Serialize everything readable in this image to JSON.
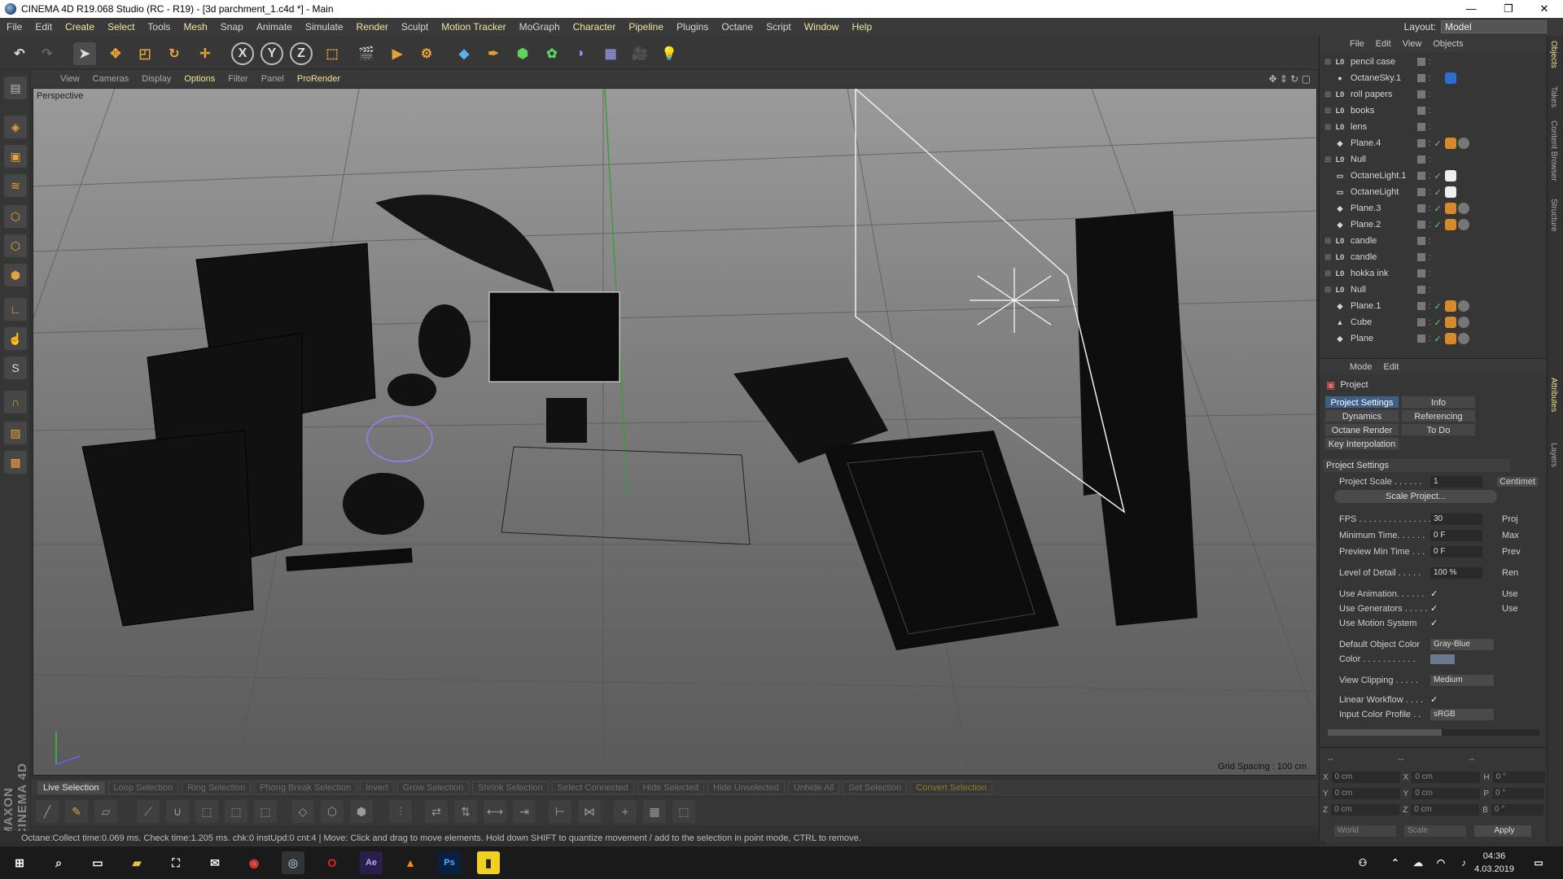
{
  "window": {
    "title": "CINEMA 4D R19.068 Studio (RC - R19) - [3d parchment_1.c4d *] - Main",
    "minimize": "—",
    "maximize": "❐",
    "close": "✕"
  },
  "menubar": {
    "items": [
      "File",
      "Edit",
      "Create",
      "Select",
      "Tools",
      "Mesh",
      "Snap",
      "Animate",
      "Simulate",
      "Render",
      "Sculpt",
      "Motion Tracker",
      "MoGraph",
      "Character",
      "Pipeline",
      "Plugins",
      "Octane",
      "Script",
      "Window",
      "Help"
    ],
    "layout_label": "Layout:",
    "layout_value": "Model"
  },
  "toolbar": {
    "x_label": "X",
    "y_label": "Y",
    "z_label": "Z"
  },
  "viewport_menu": [
    "View",
    "Cameras",
    "Display",
    "Options",
    "Filter",
    "Panel",
    "ProRender"
  ],
  "viewport": {
    "name": "Perspective",
    "grid_spacing": "Grid Spacing : 100 cm"
  },
  "selection_bar": [
    "Live Selection",
    "Loop Selection",
    "Ring Selection",
    "Phong Break Selection",
    "Invert",
    "Grow Selection",
    "Shrink Selection",
    "Select Connected",
    "Hide Selected",
    "Hide Unselected",
    "Unhide All",
    "Set Selection",
    "Convert Selection"
  ],
  "status": {
    "text": "Octane:Collect time:0.069 ms.  Check time:1.205 ms.  chk:0  instUpd:0  cnt:4 | Move: Click and drag to move elements. Hold down SHIFT to quantize movement / add to the selection in point mode, CTRL to remove."
  },
  "object_manager": {
    "menu": [
      "File",
      "Edit",
      "View",
      "Objects"
    ],
    "objects": [
      {
        "name": "pencil case",
        "icon": "null-icon",
        "check": false
      },
      {
        "name": "OctaneSky.1",
        "icon": "sky-icon",
        "check": false
      },
      {
        "name": "roll papers",
        "icon": "null-icon",
        "check": false
      },
      {
        "name": "books",
        "icon": "null-icon",
        "check": false
      },
      {
        "name": "lens",
        "icon": "null-icon",
        "check": false
      },
      {
        "name": "Plane.4",
        "icon": "plane-icon",
        "check": true
      },
      {
        "name": "Null",
        "icon": "null-icon",
        "check": false
      },
      {
        "name": "OctaneLight.1",
        "icon": "light-icon",
        "check": true
      },
      {
        "name": "OctaneLight",
        "icon": "light-icon",
        "check": true
      },
      {
        "name": "Plane.3",
        "icon": "plane-icon",
        "check": true
      },
      {
        "name": "Plane.2",
        "icon": "plane-icon",
        "check": true
      },
      {
        "name": "candle",
        "icon": "null-icon",
        "check": false
      },
      {
        "name": "candle",
        "icon": "null-icon",
        "check": false
      },
      {
        "name": "hokka ink",
        "icon": "null-icon",
        "check": false
      },
      {
        "name": "Null",
        "icon": "null-icon",
        "check": false
      },
      {
        "name": "Plane.1",
        "icon": "plane-icon",
        "check": true
      },
      {
        "name": "Cube",
        "icon": "cube-icon",
        "check": true
      },
      {
        "name": "Plane",
        "icon": "plane-icon",
        "check": true
      }
    ]
  },
  "attributes": {
    "menu": [
      "Mode",
      "Edit"
    ],
    "header": "Project",
    "tabs": [
      "Project Settings",
      "Info",
      "Dynamics",
      "Referencing",
      "Octane Render",
      "To Do",
      "Key Interpolation"
    ],
    "section": "Project Settings",
    "project_scale_label": "Project Scale . . . . . .",
    "project_scale_value": "1",
    "project_scale_unit": "Centimet",
    "scale_project_button": "Scale Project...",
    "fps_label": "FPS . . . . . . . . . . . . . . .",
    "fps_value": "30",
    "fps_right": "Proj",
    "min_time_label": "Minimum Time. . . . . .",
    "min_time_value": "0 F",
    "min_time_right": "Max",
    "preview_min_label": "Preview Min Time . . .",
    "preview_min_value": "0 F",
    "preview_min_right": "Prev",
    "lod_label": "Level of Detail . . . . .",
    "lod_value": "100 %",
    "lod_right": "Ren",
    "use_anim_label": "Use Animation. . . . . .",
    "use_anim_right": "Use",
    "use_gen_label": "Use Generators . . . . .",
    "use_gen_right": "Use",
    "use_motion_label": "Use Motion System",
    "default_color_label": "Default Object Color",
    "default_color_value": "Gray-Blue",
    "color_label": "Color . . . . . . . . . . .",
    "view_clipping_label": "View Clipping . . . . .",
    "view_clipping_value": "Medium",
    "linear_label": "Linear Workflow . . . .",
    "input_profile_label": "Input Color Profile . .",
    "input_profile_value": "sRGB",
    "checkmark": "✓"
  },
  "coordinates": {
    "rows": [
      {
        "a": "X",
        "av": "0 cm",
        "b": "X",
        "bv": "0 cm",
        "c": "H",
        "cv": "0 °"
      },
      {
        "a": "Y",
        "av": "0 cm",
        "b": "Y",
        "bv": "0 cm",
        "c": "P",
        "cv": "0 °"
      },
      {
        "a": "Z",
        "av": "0 cm",
        "b": "Z",
        "bv": "0 cm",
        "c": "B",
        "cv": "0 °"
      }
    ],
    "world": "World",
    "scale": "Scale",
    "apply": "Apply",
    "dash1": "--",
    "dash2": "--",
    "dash3": "--"
  },
  "side_tabs": [
    "Objects",
    "Takes",
    "Content Browser",
    "Structure",
    "Attributes",
    "Layers"
  ],
  "brand": "MAXON CINEMA 4D",
  "taskbar": {
    "time": "04:36",
    "date": "4.03.2019"
  }
}
